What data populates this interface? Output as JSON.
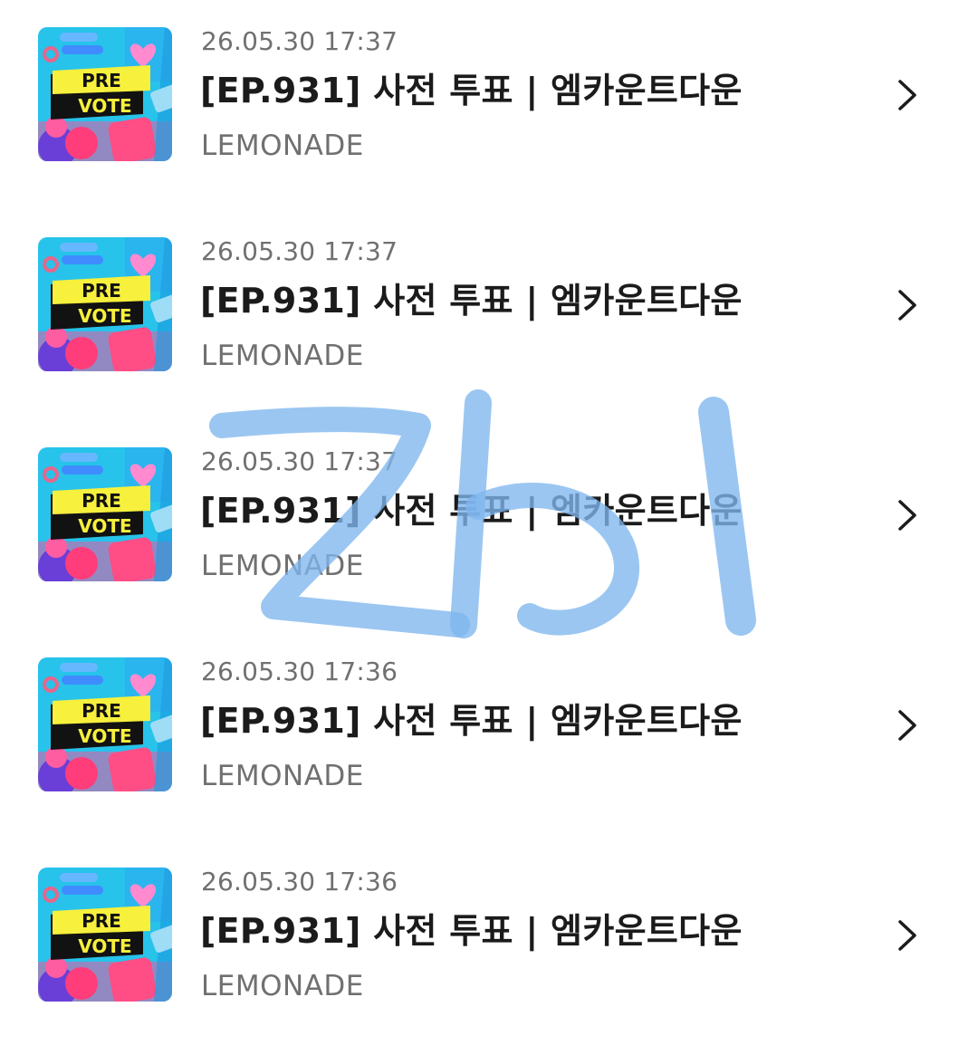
{
  "items": [
    {
      "timestamp": "26.05.30 17:37",
      "title": "[EP.931] 사전 투표 | 엠카운트다운",
      "artist": "LEMONADE",
      "thumbnail_icon": "pre-vote-thumbnail-icon",
      "thumbnail_text_top": "PRE",
      "thumbnail_text_bottom": "VOTE"
    },
    {
      "timestamp": "26.05.30 17:37",
      "title": "[EP.931] 사전 투표 | 엠카운트다운",
      "artist": "LEMONADE",
      "thumbnail_icon": "pre-vote-thumbnail-icon",
      "thumbnail_text_top": "PRE",
      "thumbnail_text_bottom": "VOTE"
    },
    {
      "timestamp": "26.05.30 17:37",
      "title": "[EP.931] 사전 투표 | 엠카운트다운",
      "artist": "LEMONADE",
      "thumbnail_icon": "pre-vote-thumbnail-icon",
      "thumbnail_text_top": "PRE",
      "thumbnail_text_bottom": "VOTE"
    },
    {
      "timestamp": "26.05.30 17:36",
      "title": "[EP.931] 사전 투표 | 엠카운트다운",
      "artist": "LEMONADE",
      "thumbnail_icon": "pre-vote-thumbnail-icon",
      "thumbnail_text_top": "PRE",
      "thumbnail_text_bottom": "VOTE"
    },
    {
      "timestamp": "26.05.30 17:36",
      "title": "[EP.931] 사전 투표 | 엠카운트다운",
      "artist": "LEMONADE",
      "thumbnail_icon": "pre-vote-thumbnail-icon",
      "thumbnail_text_top": "PRE",
      "thumbnail_text_bottom": "VOTE"
    }
  ],
  "chevron_icon": "chevron-right-icon",
  "colors": {
    "title_text": "#1b1b1b",
    "secondary_text": "#707070",
    "scribble": "#7fb6ee",
    "thumb_background": "#27c3ea",
    "thumb_banner_yellow": "#f7f03d",
    "thumb_banner_black": "#121212"
  }
}
